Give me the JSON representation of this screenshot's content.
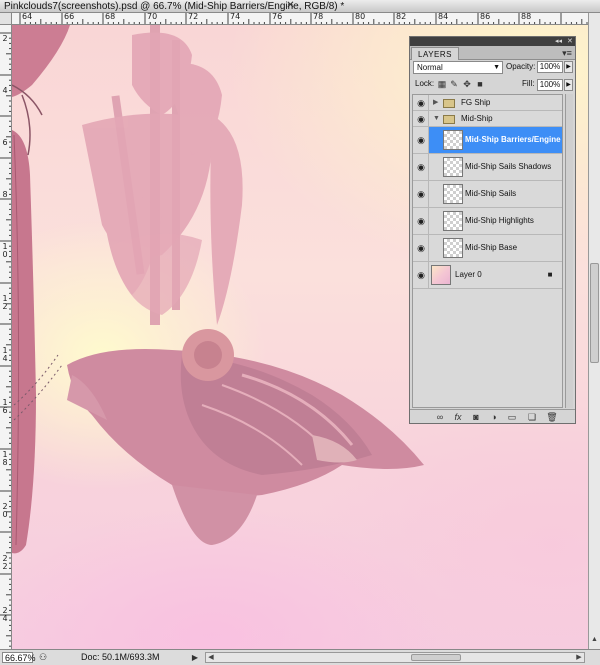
{
  "window": {
    "title": "Pinkclouds7(screenshots).psd @ 66.7% (Mid-Ship Barriers/Engine, RGB/8) *",
    "close_glyph": "✕"
  },
  "rulers": {
    "top_labels": [
      "64",
      "66",
      "68",
      "70",
      "72",
      "74",
      "76",
      "78",
      "80",
      "82",
      "84",
      "86",
      "88"
    ],
    "left_labels": [
      "2",
      "4",
      "6",
      "8",
      "10",
      "12",
      "14",
      "16",
      "18",
      "20",
      "22",
      "24"
    ]
  },
  "status": {
    "zoom": "66.67%",
    "doc_info": "Doc: 50.1M/693.3M"
  },
  "layers_panel": {
    "tab_label": "LAYERS",
    "collapse_glyph": "◂◂",
    "close_glyph": "✕",
    "menu_glyph": "▾≡",
    "blend_mode": "Normal",
    "opacity_label": "Opacity:",
    "opacity_value": "100%",
    "lock_label": "Lock:",
    "fill_label": "Fill:",
    "fill_value": "100%",
    "layers": [
      {
        "name": "FG Ship",
        "type": "group",
        "expanded": false,
        "visible": true,
        "selected": false
      },
      {
        "name": "Mid-Ship",
        "type": "group",
        "expanded": true,
        "visible": true,
        "selected": false
      },
      {
        "name": "Mid-Ship Barriers/Engine",
        "type": "layer",
        "visible": true,
        "selected": true
      },
      {
        "name": "Mid-Ship Sails Shadows",
        "type": "layer",
        "visible": true,
        "selected": false
      },
      {
        "name": "Mid-Ship Sails",
        "type": "layer",
        "visible": true,
        "selected": false
      },
      {
        "name": "Mid-Ship Highlights",
        "type": "layer",
        "visible": true,
        "selected": false
      },
      {
        "name": "Mid-Ship Base",
        "type": "layer",
        "visible": true,
        "selected": false
      },
      {
        "name": "Layer 0",
        "type": "layer",
        "visible": true,
        "selected": false,
        "locked": true
      }
    ]
  },
  "colors": {
    "selection": "#3d8ef6",
    "canvas_pink": "#f8d3dc",
    "ship_mauve": "#c98a9e"
  }
}
